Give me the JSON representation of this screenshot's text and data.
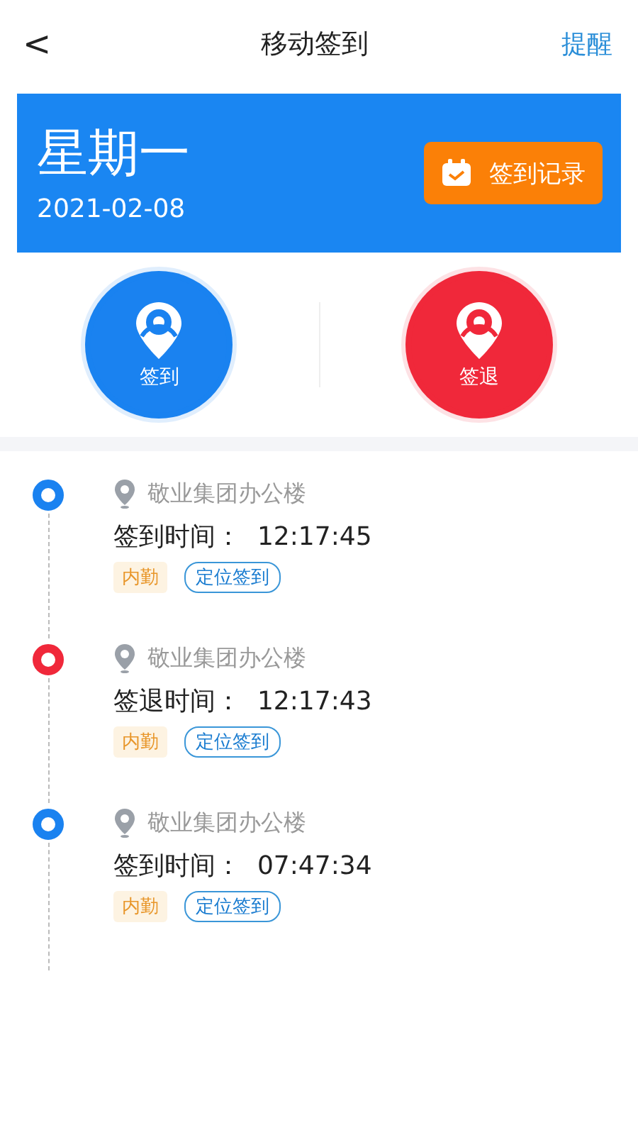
{
  "nav": {
    "back": "<",
    "title": "移动签到",
    "action": "提醒"
  },
  "banner": {
    "weekday": "星期一",
    "date": "2021-02-08",
    "button": "签到记录"
  },
  "actions": [
    {
      "label": "签到",
      "color": "#1a82f0"
    },
    {
      "label": "签退",
      "color": "#f0283a"
    }
  ],
  "records": [
    {
      "color": "#1a82f0",
      "place": "敬业集团办公楼",
      "time": "签到时间：  12:17:45",
      "tags": [
        "内勤",
        "定位签到"
      ]
    },
    {
      "color": "#f0283a",
      "place": "敬业集团办公楼",
      "time": "签退时间：  12:17:43",
      "tags": [
        "内勤",
        "定位签到"
      ]
    },
    {
      "color": "#1a82f0",
      "place": "敬业集团办公楼",
      "time": "签到时间：  07:47:34",
      "tags": [
        "内勤",
        "定位签到"
      ]
    }
  ]
}
